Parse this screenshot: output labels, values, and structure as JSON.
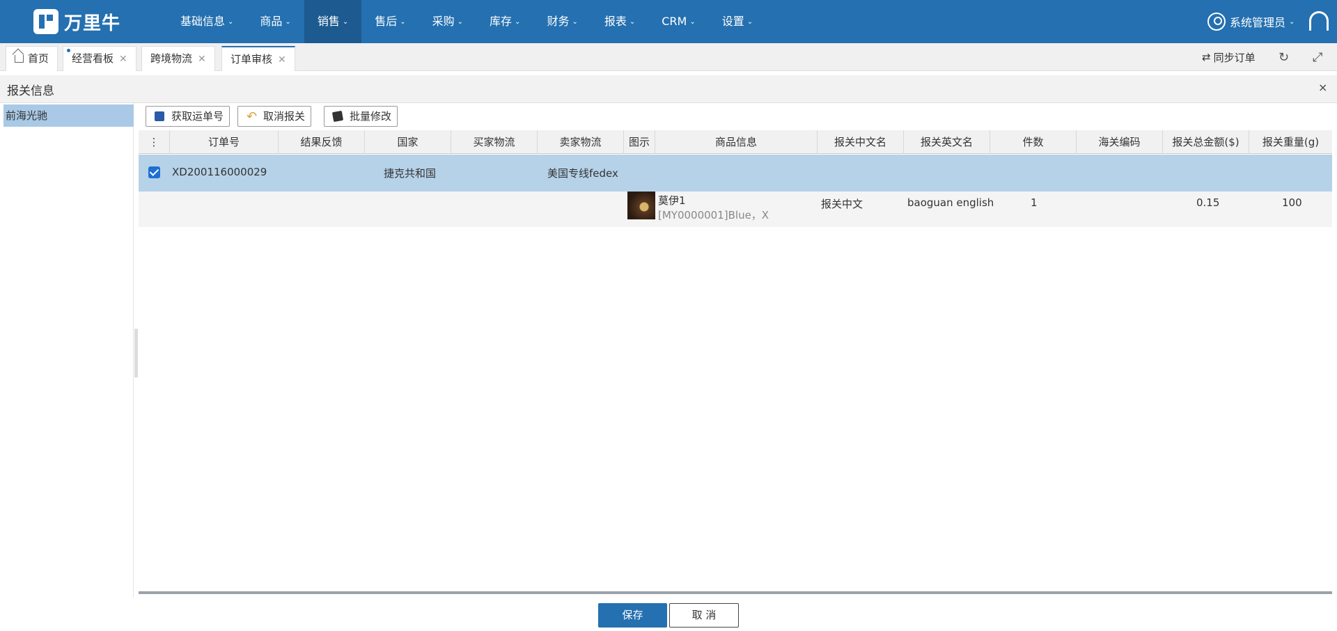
{
  "brand": {
    "name": "万里牛"
  },
  "nav": [
    "基础信息",
    "商品",
    "销售",
    "售后",
    "采购",
    "库存",
    "财务",
    "报表",
    "CRM",
    "设置"
  ],
  "nav_active": "销售",
  "user": {
    "name": "系统管理员"
  },
  "tabs": [
    {
      "label": "首页"
    },
    {
      "label": "经营看板"
    },
    {
      "label": "跨境物流"
    },
    {
      "label": "订单审核"
    }
  ],
  "tab_tools": {
    "sync_label": "同步订单"
  },
  "panel": {
    "title": "报关信息",
    "close": "×"
  },
  "left_list": {
    "items": [
      "前海光驰"
    ]
  },
  "toolbar": {
    "get_tracking": "获取运单号",
    "cancel_declare": "取消报关",
    "batch_edit": "批量修改"
  },
  "table": {
    "columns": [
      "订单号",
      "结果反馈",
      "国家",
      "买家物流",
      "卖家物流",
      "图示",
      "商品信息",
      "报关中文名",
      "报关英文名",
      "件数",
      "海关编码",
      "报关总金额($)",
      "报关重量(g)"
    ],
    "order_row": {
      "selected": true,
      "order_no": "XD200116000029",
      "country": "捷克共和国",
      "seller_logistics": "美国专线fedex"
    },
    "item_row": {
      "product_name": "莫伊1",
      "product_sku": "[MY0000001]Blue，X",
      "cn_name": "报关中文",
      "en_name": "baoguan english",
      "qty": "1",
      "amount": "0.15",
      "weight": "100"
    }
  },
  "footer": {
    "save": "保存",
    "cancel": "取 消"
  }
}
